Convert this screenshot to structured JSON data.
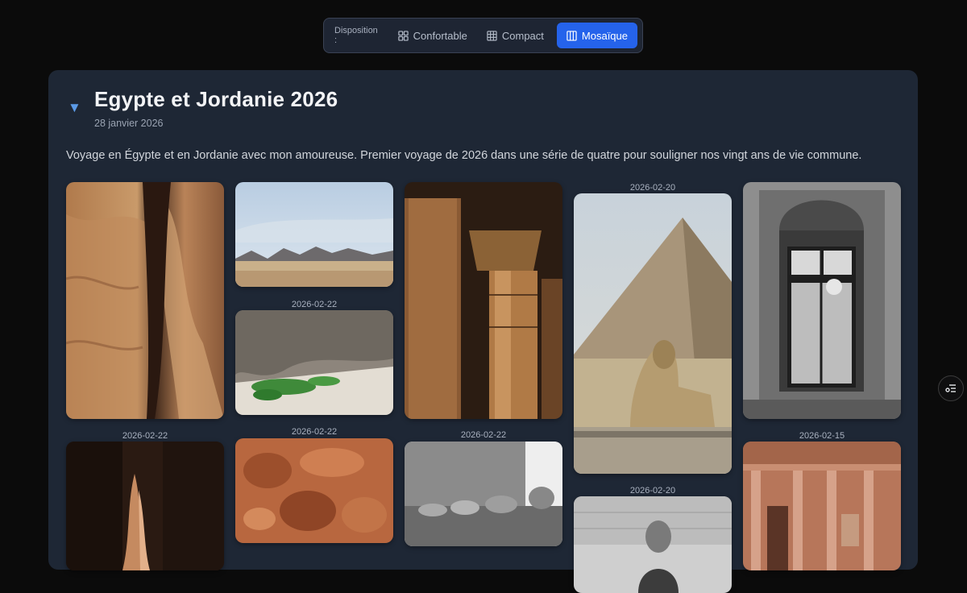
{
  "toolbar": {
    "label": "Disposition :",
    "options": [
      {
        "label": "Confortable",
        "icon": "grid-2x2-icon"
      },
      {
        "label": "Compact",
        "icon": "grid-3x3-icon"
      },
      {
        "label": "Mosaïque",
        "icon": "columns-icon",
        "active": true
      }
    ],
    "accent": "#2563eb"
  },
  "album": {
    "title": "Egypte et Jordanie 2026",
    "date": "28 janvier 2026",
    "description": "Voyage en Égypte et en Jordanie avec mon amoureuse. Premier voyage de 2026 dans une série de quatre pour souligner nos vingt ans de vie commune."
  },
  "photos": [
    {
      "caption": "",
      "subject": "sandstone canyon walls"
    },
    {
      "caption": "",
      "subject": "desert landscape with mountains"
    },
    {
      "caption": "2026-02-22",
      "subject": "rock wall with green plants"
    },
    {
      "caption": "",
      "subject": "temple columns"
    },
    {
      "caption": "2026-02-20",
      "subject": "pyramid and sphinx"
    },
    {
      "caption": "",
      "subject": "ornate window black and white"
    },
    {
      "caption": "2026-02-22",
      "subject": "dark canyon passage"
    },
    {
      "caption": "2026-02-22",
      "subject": "red eroded sandstone"
    },
    {
      "caption": "2026-02-22",
      "subject": "ram-headed sphinxes avenue"
    },
    {
      "caption": "2026-02-20",
      "subject": "man portrait black and white"
    },
    {
      "caption": "2026-02-15",
      "subject": "treasury facade petra"
    }
  ]
}
